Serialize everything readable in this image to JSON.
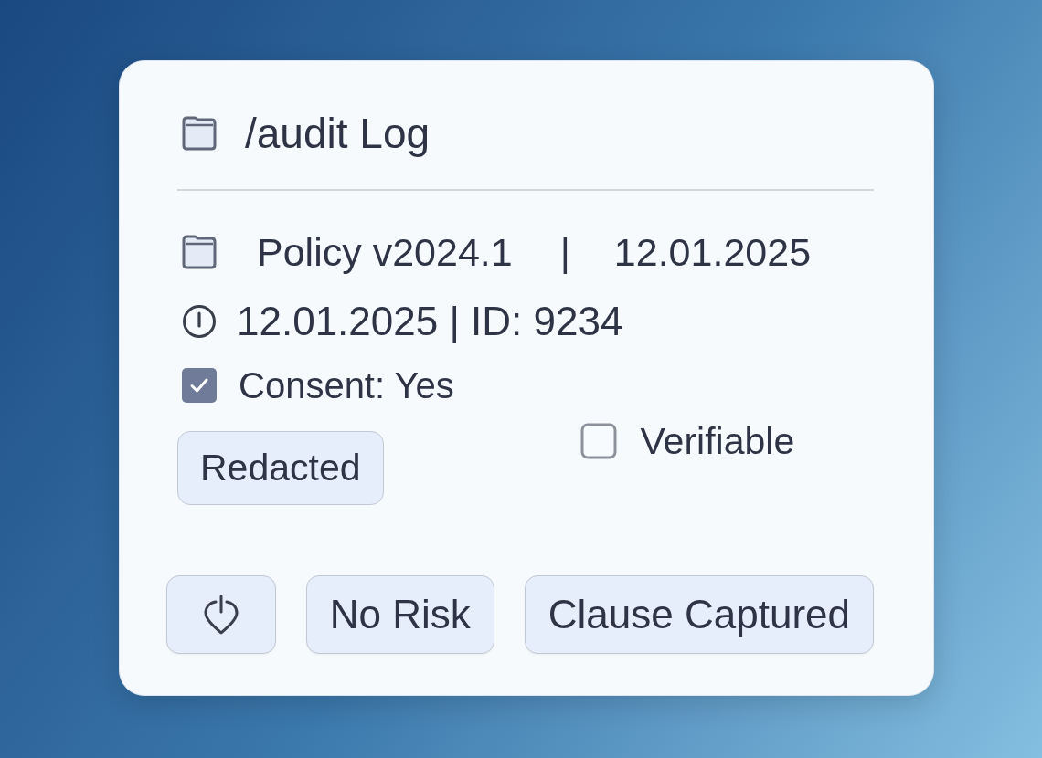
{
  "header": {
    "title": "/audit Log"
  },
  "policy_row": {
    "policy": "Policy v2024.1",
    "separator": "|",
    "date": "12.01.2025"
  },
  "record_row": {
    "text": "12.01.2025 | ID: 9234"
  },
  "consent": {
    "label": "Consent: Yes",
    "checked": true
  },
  "tags": [
    {
      "label": "Redacted"
    }
  ],
  "verifiable": {
    "label": "Verifiable",
    "checked": false
  },
  "actions": [
    {
      "kind": "icon"
    },
    {
      "kind": "text",
      "label": "No Risk"
    },
    {
      "kind": "text",
      "label": "Clause Captured"
    }
  ]
}
